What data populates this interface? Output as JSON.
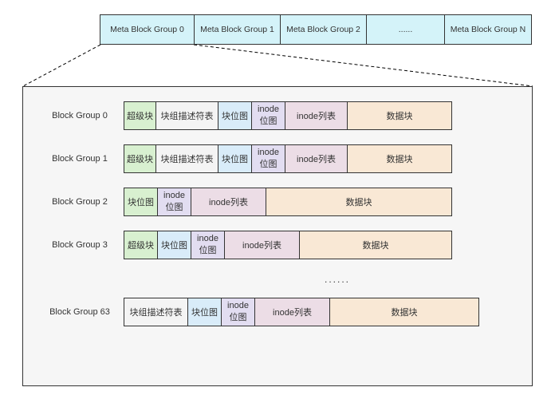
{
  "meta": {
    "group0": "Meta Block Group 0",
    "group1": "Meta Block Group 1",
    "group2": "Meta Block Group 2",
    "ellipsis": "......",
    "groupN": "Meta Block Group N"
  },
  "blocks": {
    "superblock": "超级块",
    "group_desc": "块组描述符表",
    "block_bitmap": "块位图",
    "inode_bitmap": "inode\n位图",
    "inode_list": "inode列表",
    "data_block": "数据块"
  },
  "rows": {
    "g0": "Block Group 0",
    "g1": "Block Group 1",
    "g2": "Block Group 2",
    "g3": "Block Group 3",
    "ellipsis": "......",
    "g63": "Block Group 63"
  },
  "chart_data": {
    "type": "table",
    "title": "Meta Block Group / Block Group layout",
    "meta_groups": [
      "Meta Block Group 0",
      "Meta Block Group 1",
      "Meta Block Group 2",
      "......",
      "Meta Block Group N"
    ],
    "block_group_rows": [
      {
        "label": "Block Group 0",
        "cells": [
          "超级块",
          "块组描述符表",
          "块位图",
          "inode位图",
          "inode列表",
          "数据块"
        ]
      },
      {
        "label": "Block Group 1",
        "cells": [
          "超级块",
          "块组描述符表",
          "块位图",
          "inode位图",
          "inode列表",
          "数据块"
        ]
      },
      {
        "label": "Block Group 2",
        "cells": [
          "块位图",
          "inode位图",
          "inode列表",
          "数据块"
        ]
      },
      {
        "label": "Block Group 3",
        "cells": [
          "超级块",
          "块位图",
          "inode位图",
          "inode列表",
          "数据块"
        ]
      },
      {
        "label": "......",
        "cells": []
      },
      {
        "label": "Block Group 63",
        "cells": [
          "块组描述符表",
          "块位图",
          "inode位图",
          "inode列表",
          "数据块"
        ]
      }
    ]
  }
}
